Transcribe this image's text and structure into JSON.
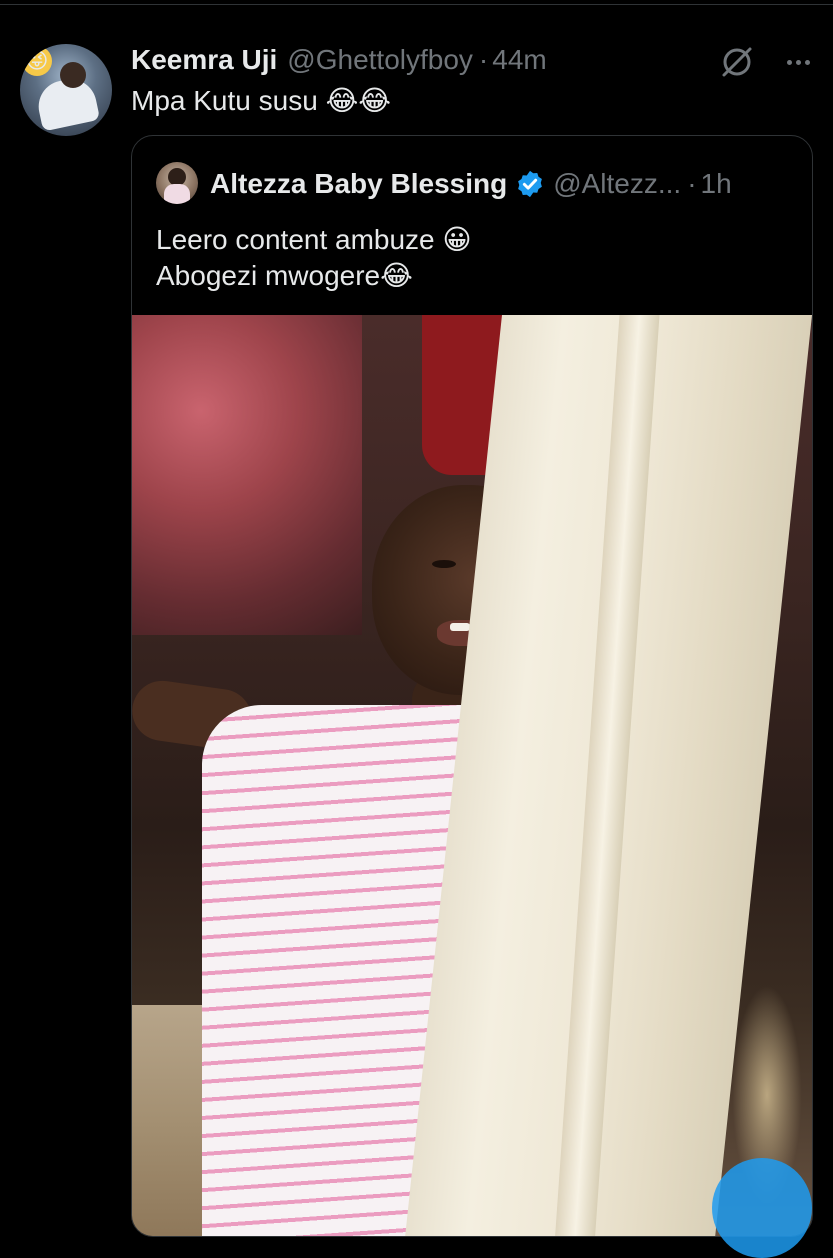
{
  "tweet": {
    "author_name": "Keemra Uji",
    "author_handle": "@Ghettolyfboy",
    "separator": "·",
    "time": "44m",
    "text": "Mpa Kutu susu",
    "emojis": "😂😂"
  },
  "quote": {
    "author_name": "Altezza Baby Blessing",
    "author_handle": "@Altezz...",
    "separator": "·",
    "time": "1h",
    "line1": "Leero content ambuze",
    "line1_emoji": "😀",
    "line2": "Abogezi mwogere",
    "line2_emoji": "😂"
  },
  "icons": {
    "grok": "grok-icon",
    "more": "more-icon",
    "verified": "verified-badge-icon"
  },
  "colors": {
    "background": "#000000",
    "text": "#e7e9ea",
    "secondary": "#71767b",
    "border": "#2f3336",
    "accent": "#1d9bf0"
  }
}
